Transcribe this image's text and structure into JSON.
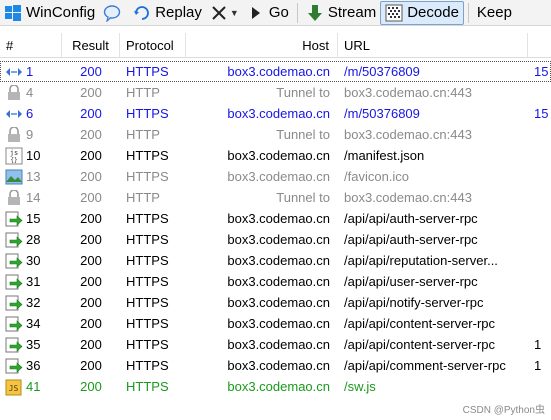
{
  "toolbar": {
    "items": [
      {
        "label": "WinConfig",
        "icon": "windows-icon"
      },
      {
        "label": "",
        "icon": "comment-icon"
      },
      {
        "label": "Replay",
        "icon": "replay-icon"
      },
      {
        "label": "",
        "icon": "remove-icon"
      },
      {
        "label": "Go",
        "icon": "go-icon"
      },
      {
        "label": "Stream",
        "icon": "stream-icon"
      },
      {
        "label": "Decode",
        "icon": "decode-icon"
      },
      {
        "label": "Keep",
        "icon": ""
      }
    ]
  },
  "columns": {
    "num": "#",
    "result": "Result",
    "protocol": "Protocol",
    "host": "Host",
    "url": "URL"
  },
  "rows": [
    {
      "num": "1",
      "result": "200",
      "protocol": "HTTPS",
      "host": "box3.codemao.cn",
      "url": "/m/50376809",
      "extra": "15",
      "kind": "blue",
      "icon": "websocket-icon"
    },
    {
      "num": "4",
      "result": "200",
      "protocol": "HTTP",
      "host": "Tunnel to",
      "url": "box3.codemao.cn:443",
      "extra": "",
      "kind": "gray",
      "icon": "lock-icon"
    },
    {
      "num": "6",
      "result": "200",
      "protocol": "HTTPS",
      "host": "box3.codemao.cn",
      "url": "/m/50376809",
      "extra": "15",
      "kind": "blue",
      "icon": "websocket-icon"
    },
    {
      "num": "9",
      "result": "200",
      "protocol": "HTTP",
      "host": "Tunnel to",
      "url": "box3.codemao.cn:443",
      "extra": "",
      "kind": "gray",
      "icon": "lock-icon"
    },
    {
      "num": "10",
      "result": "200",
      "protocol": "HTTPS",
      "host": "box3.codemao.cn",
      "url": "/manifest.json",
      "extra": "",
      "kind": "normal",
      "icon": "json-icon"
    },
    {
      "num": "13",
      "result": "200",
      "protocol": "HTTPS",
      "host": "box3.codemao.cn",
      "url": "/favicon.ico",
      "extra": "",
      "kind": "gray",
      "icon": "image-icon"
    },
    {
      "num": "14",
      "result": "200",
      "protocol": "HTTP",
      "host": "Tunnel to",
      "url": "box3.codemao.cn:443",
      "extra": "",
      "kind": "gray",
      "icon": "lock-icon"
    },
    {
      "num": "15",
      "result": "200",
      "protocol": "HTTPS",
      "host": "box3.codemao.cn",
      "url": "/api/api/auth-server-rpc",
      "extra": "",
      "kind": "normal",
      "icon": "request-icon"
    },
    {
      "num": "28",
      "result": "200",
      "protocol": "HTTPS",
      "host": "box3.codemao.cn",
      "url": "/api/api/auth-server-rpc",
      "extra": "",
      "kind": "normal",
      "icon": "request-icon"
    },
    {
      "num": "30",
      "result": "200",
      "protocol": "HTTPS",
      "host": "box3.codemao.cn",
      "url": "/api/api/reputation-server...",
      "extra": "",
      "kind": "normal",
      "icon": "request-icon"
    },
    {
      "num": "31",
      "result": "200",
      "protocol": "HTTPS",
      "host": "box3.codemao.cn",
      "url": "/api/api/user-server-rpc",
      "extra": "",
      "kind": "normal",
      "icon": "request-icon"
    },
    {
      "num": "32",
      "result": "200",
      "protocol": "HTTPS",
      "host": "box3.codemao.cn",
      "url": "/api/api/notify-server-rpc",
      "extra": "",
      "kind": "normal",
      "icon": "request-icon"
    },
    {
      "num": "34",
      "result": "200",
      "protocol": "HTTPS",
      "host": "box3.codemao.cn",
      "url": "/api/api/content-server-rpc",
      "extra": "",
      "kind": "normal",
      "icon": "request-icon"
    },
    {
      "num": "35",
      "result": "200",
      "protocol": "HTTPS",
      "host": "box3.codemao.cn",
      "url": "/api/api/content-server-rpc",
      "extra": "1",
      "kind": "normal",
      "icon": "request-icon"
    },
    {
      "num": "36",
      "result": "200",
      "protocol": "HTTPS",
      "host": "box3.codemao.cn",
      "url": "/api/api/comment-server-rpc",
      "extra": "1",
      "kind": "normal",
      "icon": "request-icon"
    },
    {
      "num": "41",
      "result": "200",
      "protocol": "HTTPS",
      "host": "box3.codemao.cn",
      "url": "/sw.js",
      "extra": "",
      "kind": "green",
      "icon": "script-icon"
    }
  ],
  "watermark": "CSDN @Python虫",
  "colors": {
    "blue": "#1515e8",
    "gray": "#8a8a8a",
    "green": "#1a9a1a",
    "normal": "#000000"
  }
}
